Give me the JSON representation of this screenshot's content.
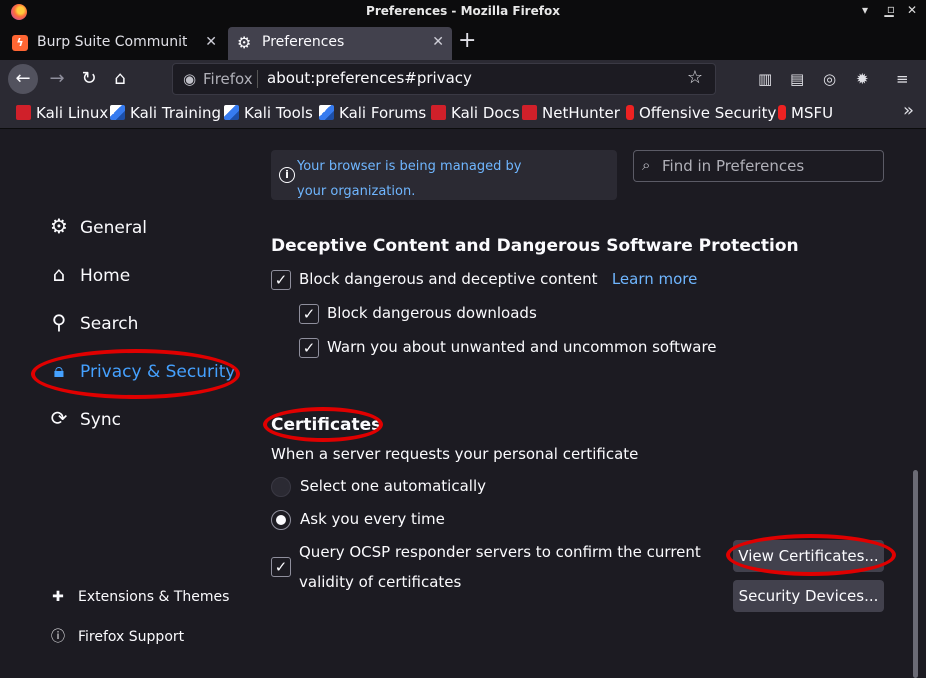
{
  "window": {
    "title": "Preferences - Mozilla Firefox"
  },
  "tabs": [
    {
      "label": "Burp Suite Community Ed",
      "icon": "burp-icon"
    },
    {
      "label": "Preferences",
      "icon": "gear-icon"
    }
  ],
  "nav": {
    "identity_label": "Firefox",
    "url": "about:preferences#privacy"
  },
  "bookmarks": [
    {
      "label": "Kali Linux"
    },
    {
      "label": "Kali Training"
    },
    {
      "label": "Kali Tools"
    },
    {
      "label": "Kali Forums"
    },
    {
      "label": "Kali Docs"
    },
    {
      "label": "NetHunter"
    },
    {
      "label": "Offensive Security"
    },
    {
      "label": "MSFU"
    }
  ],
  "managed_notice": "Your browser is being managed by your organization.",
  "search": {
    "placeholder": "Find in Preferences"
  },
  "sidebar": {
    "items": [
      {
        "label": "General",
        "icon": "gear-icon"
      },
      {
        "label": "Home",
        "icon": "home-icon"
      },
      {
        "label": "Search",
        "icon": "search-icon"
      },
      {
        "label": "Privacy & Security",
        "icon": "lock-icon"
      },
      {
        "label": "Sync",
        "icon": "sync-icon"
      }
    ],
    "footer": [
      {
        "label": "Extensions & Themes",
        "icon": "puzzle-icon"
      },
      {
        "label": "Firefox Support",
        "icon": "help-icon"
      }
    ]
  },
  "deceptive": {
    "heading": "Deceptive Content and Dangerous Software Protection",
    "block_label": "Block dangerous and deceptive content",
    "learn_more": "Learn more",
    "downloads_label": "Block dangerous downloads",
    "unwanted_label": "Warn you about unwanted and uncommon software"
  },
  "certificates": {
    "heading": "Certificates",
    "desc": "When a server requests your personal certificate",
    "option_auto": "Select one automatically",
    "option_ask": "Ask you every time",
    "ocsp_line1": "Query OCSP responder servers to confirm the current",
    "ocsp_line2": "validity of certificates",
    "view_button": "View Certificates...",
    "devices_button": "Security Devices..."
  },
  "colors": {
    "accent": "#45a1ff",
    "annotation": "#e00000"
  }
}
